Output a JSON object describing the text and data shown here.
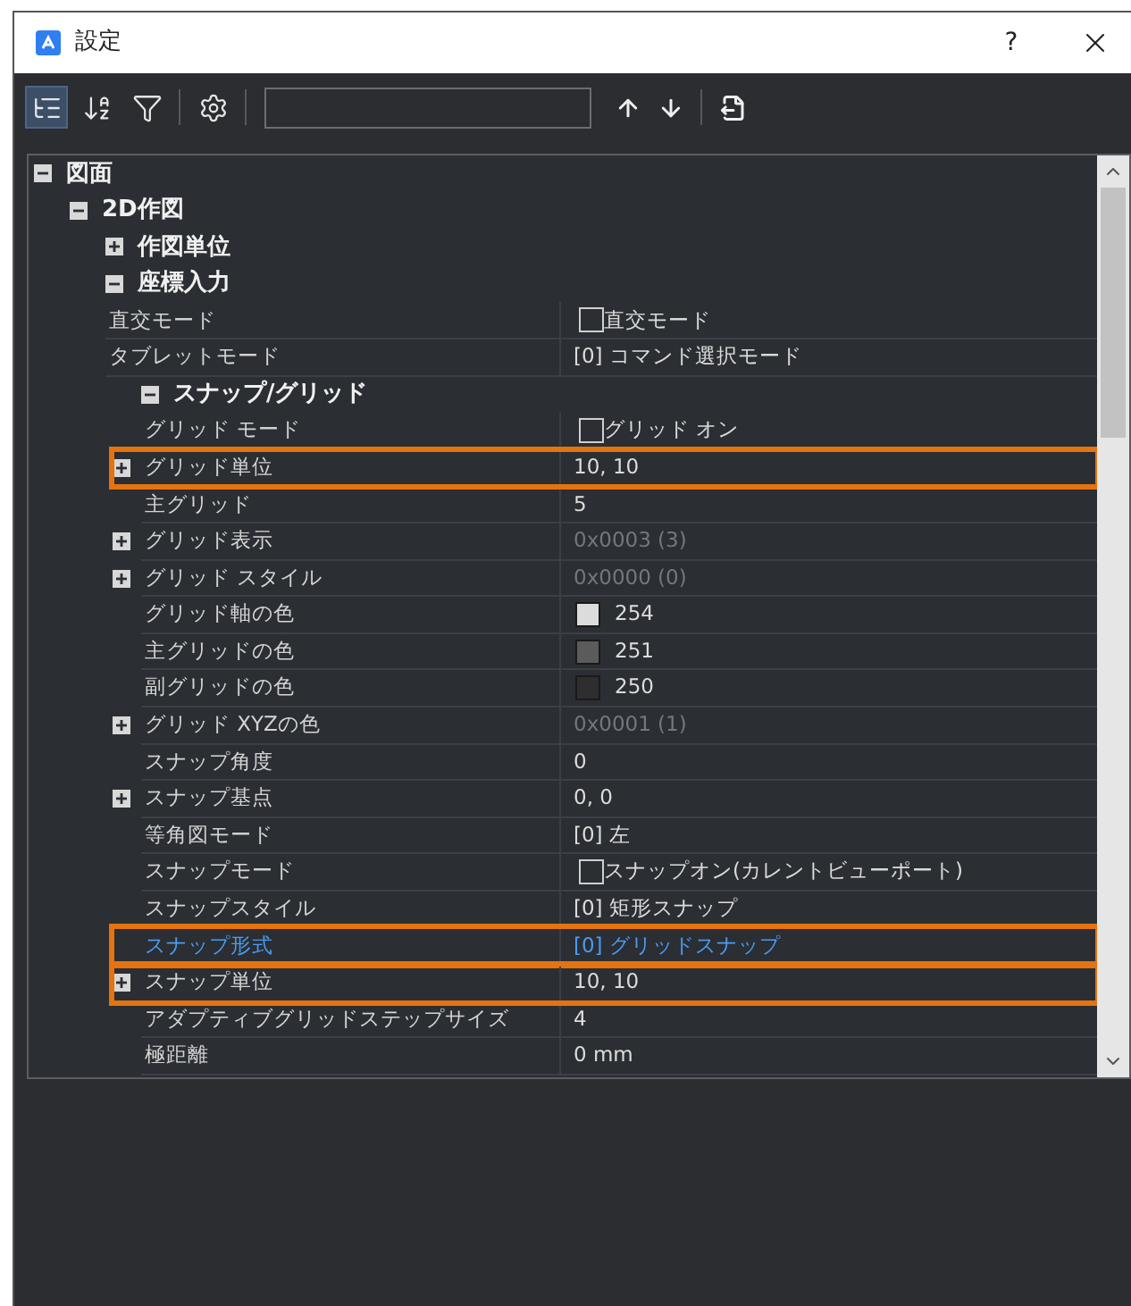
{
  "window": {
    "title": "設定",
    "help": "?"
  },
  "toolbar": {
    "buttons": [
      {
        "kind": "tree",
        "selected": true
      },
      {
        "kind": "sort",
        "selected": false
      },
      {
        "kind": "filter",
        "selected": false
      },
      {
        "kind": "settings",
        "selected": false
      }
    ],
    "nav": [
      {
        "kind": "up"
      },
      {
        "kind": "down"
      },
      {
        "kind": "export"
      }
    ]
  },
  "tree": [
    {
      "kind": "group",
      "label": "図面",
      "expanded": true,
      "children": [
        {
          "kind": "group",
          "label": "2D作図",
          "expanded": true,
          "children": [
            {
              "kind": "group",
              "label": "作図単位",
              "expanded": false
            },
            {
              "kind": "group",
              "label": "座標入力",
              "expanded": true,
              "children": [
                {
                  "kind": "property",
                  "name": "直交モード",
                  "highlighted": false,
                  "modified": false,
                  "value": {
                    "kind": "checkbox",
                    "checked": false,
                    "label": "直交モード"
                  }
                },
                {
                  "kind": "property",
                  "name": "タブレットモード",
                  "highlighted": false,
                  "modified": false,
                  "value": {
                    "kind": "text",
                    "text": "[0] コマンド選択モード",
                    "dimmed": false
                  }
                },
                {
                  "kind": "group",
                  "label": "スナップ/グリッド",
                  "expanded": true,
                  "children": [
                    {
                      "kind": "property",
                      "name": "グリッド モード",
                      "highlighted": false,
                      "modified": false,
                      "value": {
                        "kind": "checkbox",
                        "checked": false,
                        "label": "グリッド オン"
                      }
                    },
                    {
                      "kind": "property",
                      "name": "グリッド単位",
                      "expanded": false,
                      "highlighted": true,
                      "modified": false,
                      "value": {
                        "kind": "text",
                        "text": "10, 10",
                        "dimmed": false
                      }
                    },
                    {
                      "kind": "property",
                      "name": "主グリッド",
                      "highlighted": false,
                      "modified": false,
                      "value": {
                        "kind": "text",
                        "text": "5",
                        "dimmed": false
                      }
                    },
                    {
                      "kind": "property",
                      "name": "グリッド表示",
                      "expanded": false,
                      "highlighted": false,
                      "modified": false,
                      "value": {
                        "kind": "text",
                        "text": "0x0003 (3)",
                        "dimmed": true
                      }
                    },
                    {
                      "kind": "property",
                      "name": "グリッド スタイル",
                      "expanded": false,
                      "highlighted": false,
                      "modified": false,
                      "value": {
                        "kind": "text",
                        "text": "0x0000 (0)",
                        "dimmed": true
                      }
                    },
                    {
                      "kind": "property",
                      "name": "グリッド軸の色",
                      "highlighted": false,
                      "modified": false,
                      "value": {
                        "kind": "color",
                        "color": "#dcdcdc",
                        "text": "254"
                      }
                    },
                    {
                      "kind": "property",
                      "name": "主グリッドの色",
                      "highlighted": false,
                      "modified": false,
                      "value": {
                        "kind": "color",
                        "color": "#5b5b5b",
                        "text": "251"
                      }
                    },
                    {
                      "kind": "property",
                      "name": "副グリッドの色",
                      "highlighted": false,
                      "modified": false,
                      "value": {
                        "kind": "color",
                        "color": "#2e2e2e",
                        "text": "250"
                      }
                    },
                    {
                      "kind": "property",
                      "name": "グリッド XYZの色",
                      "expanded": false,
                      "highlighted": false,
                      "modified": false,
                      "value": {
                        "kind": "text",
                        "text": "0x0001 (1)",
                        "dimmed": true
                      }
                    },
                    {
                      "kind": "property",
                      "name": "スナップ角度",
                      "highlighted": false,
                      "modified": false,
                      "value": {
                        "kind": "text",
                        "text": "0",
                        "dimmed": false
                      }
                    },
                    {
                      "kind": "property",
                      "name": "スナップ基点",
                      "expanded": false,
                      "highlighted": false,
                      "modified": false,
                      "value": {
                        "kind": "text",
                        "text": "0, 0",
                        "dimmed": false
                      }
                    },
                    {
                      "kind": "property",
                      "name": "等角図モード",
                      "highlighted": false,
                      "modified": false,
                      "value": {
                        "kind": "text",
                        "text": "[0] 左",
                        "dimmed": false
                      }
                    },
                    {
                      "kind": "property",
                      "name": "スナップモード",
                      "highlighted": false,
                      "modified": false,
                      "value": {
                        "kind": "checkbox",
                        "checked": false,
                        "label": "スナップオン(カレントビューポート)"
                      }
                    },
                    {
                      "kind": "property",
                      "name": "スナップスタイル",
                      "highlighted": false,
                      "modified": false,
                      "value": {
                        "kind": "text",
                        "text": "[0] 矩形スナップ",
                        "dimmed": false
                      }
                    },
                    {
                      "kind": "property",
                      "name": "スナップ形式",
                      "highlighted": true,
                      "modified": true,
                      "value": {
                        "kind": "text",
                        "text": "[0] グリッドスナップ",
                        "dimmed": false
                      }
                    },
                    {
                      "kind": "property",
                      "name": "スナップ単位",
                      "expanded": false,
                      "highlighted": true,
                      "modified": false,
                      "value": {
                        "kind": "text",
                        "text": "10, 10",
                        "dimmed": false
                      }
                    },
                    {
                      "kind": "property",
                      "name": "アダプティブグリッドステップサイズ",
                      "highlighted": false,
                      "modified": false,
                      "value": {
                        "kind": "text",
                        "text": "4",
                        "dimmed": false
                      }
                    },
                    {
                      "kind": "property",
                      "name": "極距離",
                      "highlighted": false,
                      "modified": false,
                      "value": {
                        "kind": "text",
                        "text": "0 mm",
                        "dimmed": false
                      }
                    }
                  ]
                }
              ]
            }
          ]
        }
      ]
    }
  ]
}
